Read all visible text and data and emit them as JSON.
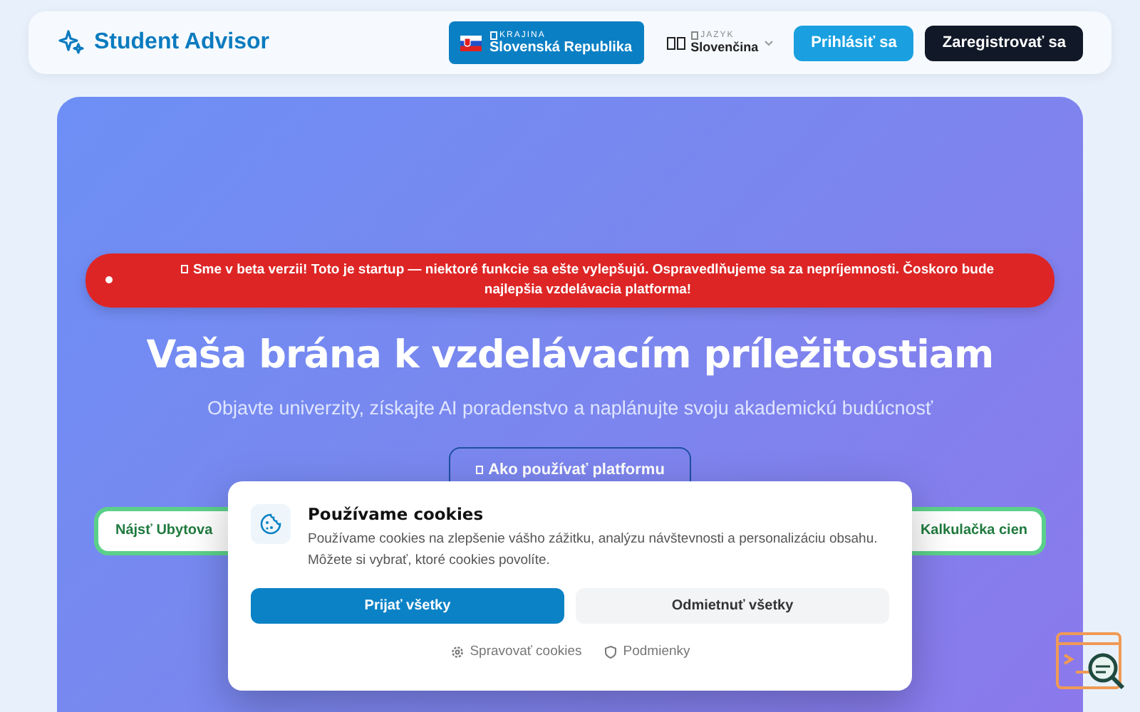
{
  "header": {
    "logo": "Student Advisor",
    "country": {
      "label": "KRAJINA",
      "value": "Slovenská Republika"
    },
    "language": {
      "label": "JAZYK",
      "value": "Slovenčina"
    },
    "login": "Prihlásiť sa",
    "register": "Zaregistrovať sa"
  },
  "hero": {
    "banner": "Sme v beta verzii! Toto je startup — niektoré funkcie sa ešte vylepšujú. Ospravedlňujeme sa za nepríjemnosti. Čoskoro bude najlepšia vzdelávacia platforma!",
    "title": "Vaša brána k vzdelávacím príležitostiam",
    "subtitle": "Objavte univerzity, získajte AI poradenstvo a naplánujte svoju akademickú budúcnosť",
    "guide_button": "Ako používať platformu",
    "actions": [
      "Nájsť Ubytova",
      "Kalkulačka cien"
    ]
  },
  "cookies": {
    "title": "Používame cookies",
    "text": "Používame cookies na zlepšenie vášho zážitku, analýzu návštevnosti a personalizáciu obsahu. Môžete si vybrať, ktoré cookies povolíte.",
    "accept": "Prijať všetky",
    "reject": "Odmietnuť všetky",
    "manage": "Spravovať cookies",
    "terms": "Podmienky"
  }
}
